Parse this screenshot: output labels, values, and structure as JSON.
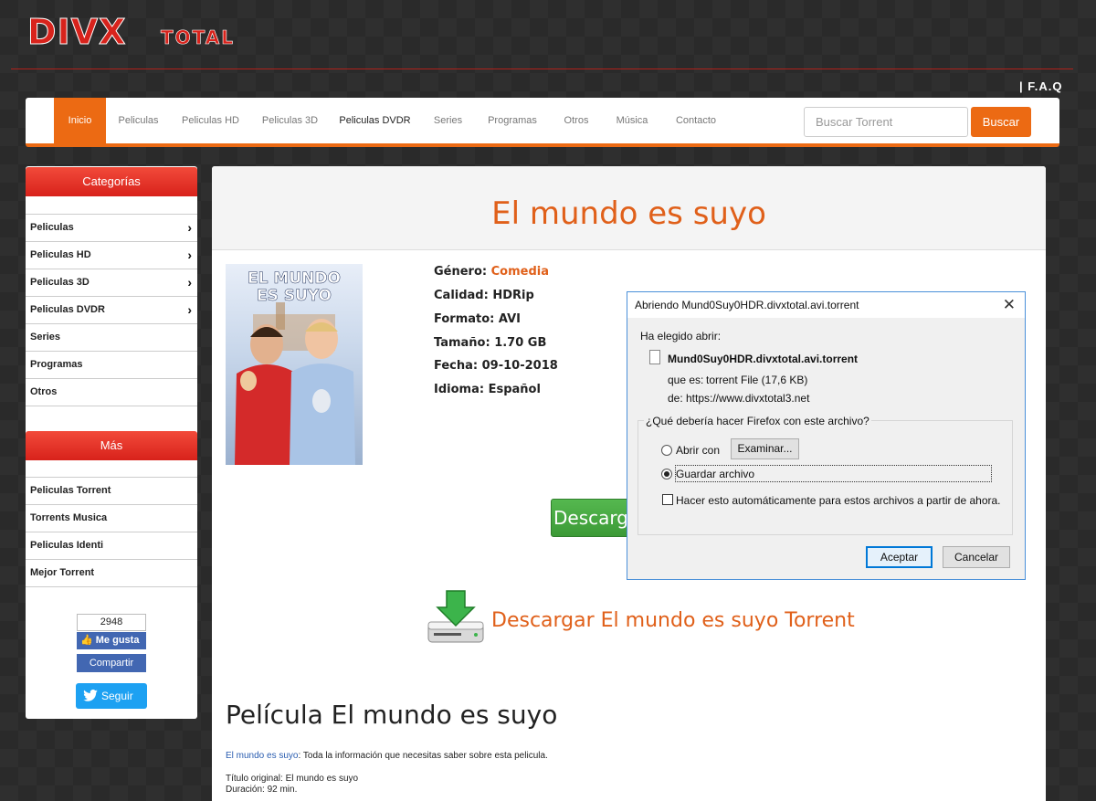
{
  "header": {
    "logo_text_main": "DIVX",
    "logo_text_sub": "TOTAL",
    "faq_link": "| F.A.Q"
  },
  "nav": {
    "items": [
      {
        "label": "Inicio",
        "active": true
      },
      {
        "label": "Peliculas"
      },
      {
        "label": "Peliculas HD"
      },
      {
        "label": "Peliculas 3D"
      },
      {
        "label": "Peliculas DVDR"
      },
      {
        "label": "Series"
      },
      {
        "label": "Programas"
      },
      {
        "label": "Otros"
      },
      {
        "label": "Música"
      },
      {
        "label": "Contacto"
      }
    ],
    "search_placeholder": "Buscar Torrent",
    "search_button": "Buscar"
  },
  "sidebar": {
    "categories_title": "Categorías",
    "categories": [
      {
        "label": "Peliculas",
        "has_submenu": true
      },
      {
        "label": "Peliculas HD",
        "has_submenu": true
      },
      {
        "label": "Peliculas 3D",
        "has_submenu": true
      },
      {
        "label": "Peliculas DVDR",
        "has_submenu": true
      },
      {
        "label": "Series",
        "has_submenu": false
      },
      {
        "label": "Programas",
        "has_submenu": false
      },
      {
        "label": "Otros",
        "has_submenu": false
      }
    ],
    "more_title": "Más",
    "more": [
      {
        "label": "Peliculas Torrent"
      },
      {
        "label": "Torrents Musica"
      },
      {
        "label": "Peliculas Identi"
      },
      {
        "label": "Mejor Torrent"
      }
    ],
    "social": {
      "like_count": "2948",
      "like_label": "Me gusta",
      "share_label": "Compartir",
      "follow_label": "Seguir"
    }
  },
  "movie": {
    "title": "El mundo es suyo",
    "poster_title_line1": "EL MUNDO",
    "poster_title_line2": "ES SUYO",
    "info": [
      {
        "label": "Género:",
        "value": "Comedia",
        "highlight": true
      },
      {
        "label": "Calidad:",
        "value": "HDRip"
      },
      {
        "label": "Formato:",
        "value": "AVI"
      },
      {
        "label": "Tamaño:",
        "value": "1.70 GB"
      },
      {
        "label": "Fecha:",
        "value": "09-10-2018"
      },
      {
        "label": "Idioma:",
        "value": "Español"
      }
    ],
    "download_button": "Descargar",
    "download_link": "Descargar El mundo es suyo Torrent",
    "section_title": "Película El mundo es suyo",
    "intro_link": "El mundo es suyo",
    "intro_text": ": Toda la información que necesitas saber sobre esta pelicula.",
    "original_title": "Título original: El mundo es suyo",
    "duration": "Duración: 92 min."
  },
  "dialog": {
    "title": "Abriendo Mund0Suy0HDR.divxtotal.avi.torrent",
    "chosen_label": "Ha elegido abrir:",
    "filename": "Mund0Suy0HDR.divxtotal.avi.torrent",
    "type_label": "que es:",
    "type_value": "torrent File (17,6 KB)",
    "from_label": "de:",
    "from_value": "https://www.divxtotal3.net",
    "question": "¿Qué debería hacer Firefox con este archivo?",
    "open_with": "Abrir con",
    "browse": "Examinar...",
    "save_file": "Guardar archivo",
    "selected_option": "save",
    "auto_label": "Hacer esto automáticamente para estos archivos a partir de ahora.",
    "auto_checked": false,
    "accept": "Aceptar",
    "cancel": "Cancelar"
  }
}
